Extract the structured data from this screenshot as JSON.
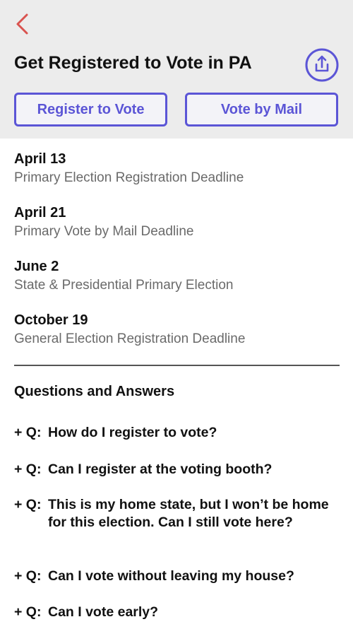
{
  "header": {
    "back_icon": "chevron-left-icon",
    "title": "Get Registered to Vote in PA",
    "share_icon": "share-upload-icon",
    "register_button": "Register to Vote",
    "mail_button": "Vote by Mail"
  },
  "dates": [
    {
      "date": "April 13",
      "desc": "Primary Election Registration Deadline"
    },
    {
      "date": "April 21",
      "desc": "Primary Vote by Mail Deadline"
    },
    {
      "date": "June 2",
      "desc": "State & Presidential Primary Election"
    },
    {
      "date": "October 19",
      "desc": "General Election Registration Deadline"
    }
  ],
  "qa": {
    "heading": "Questions and Answers",
    "prefix": "+ Q:",
    "questions": [
      "How do I register to vote?",
      "Can I register at the voting booth?",
      "This is my home state, but I won’t be home for this election. Can I still vote here?",
      "Can I vote without leaving my house?",
      "Can I vote early?"
    ]
  },
  "colors": {
    "accent": "#5b55d6",
    "back_arrow": "#d9534f",
    "header_bg": "#ececec",
    "muted_text": "#6a6a6a"
  }
}
